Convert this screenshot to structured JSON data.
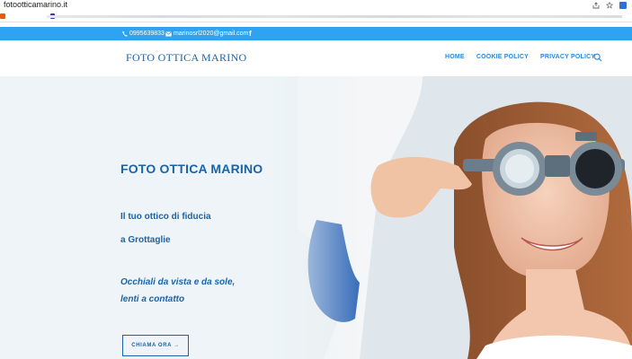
{
  "browser": {
    "url": "fotootticamarino.it",
    "icons": [
      "share-icon",
      "star-icon",
      "extension-icon"
    ]
  },
  "topbar": {
    "phone": "0995639833",
    "email": "marinosrl2020@gmail.com",
    "social": "f",
    "background": "#2ea3f2"
  },
  "header": {
    "logo": "FOTO OTTICA MARINO",
    "nav": [
      "HOME",
      "COOKIE POLICY",
      "PRIVACY POLICY"
    ]
  },
  "hero": {
    "title": "FOTO OTTICA MARINO",
    "line1": "Il tuo ottico di fiducia",
    "line2": "a Grottaglie",
    "italic1": "Occhiali da vista e da sole,",
    "italic2": "lenti a contatto",
    "cta": "CHIAMA ORA →"
  },
  "colors": {
    "brand": "#1c63a6",
    "nav": "#2b87da",
    "accent": "#2ea3f2"
  }
}
